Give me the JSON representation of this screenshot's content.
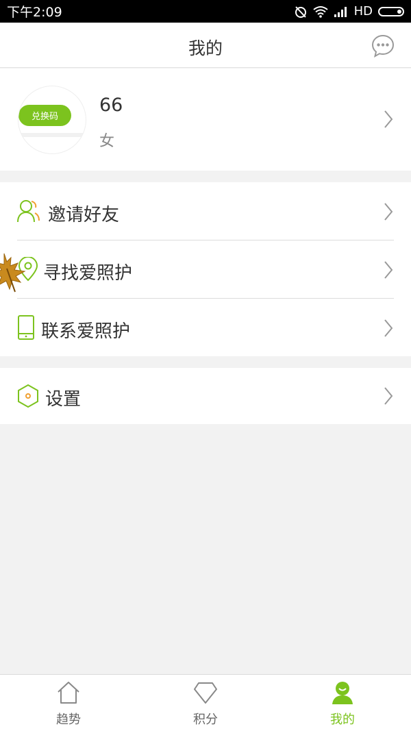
{
  "status": {
    "time": "下午2:09",
    "network": "HD"
  },
  "header": {
    "title": "我的"
  },
  "profile": {
    "name": "66",
    "gender": "女",
    "redeem_label": "兑换码"
  },
  "menu": {
    "group1": [
      {
        "label": "邀请好友",
        "icon": "users-icon"
      },
      {
        "label": "寻找爱照护",
        "icon": "location-pin-icon"
      },
      {
        "label": "联系爱照护",
        "icon": "phone-icon"
      }
    ],
    "group2": [
      {
        "label": "设置",
        "icon": "hexagon-settings-icon"
      }
    ]
  },
  "tabs": [
    {
      "label": "趋势",
      "icon": "home-icon",
      "active": false
    },
    {
      "label": "积分",
      "icon": "diamond-icon",
      "active": false
    },
    {
      "label": "我的",
      "icon": "person-icon",
      "active": true
    }
  ],
  "colors": {
    "accent": "#7cc31e",
    "text": "#333333",
    "background": "#f2f2f2",
    "statusbar": "#000000"
  }
}
